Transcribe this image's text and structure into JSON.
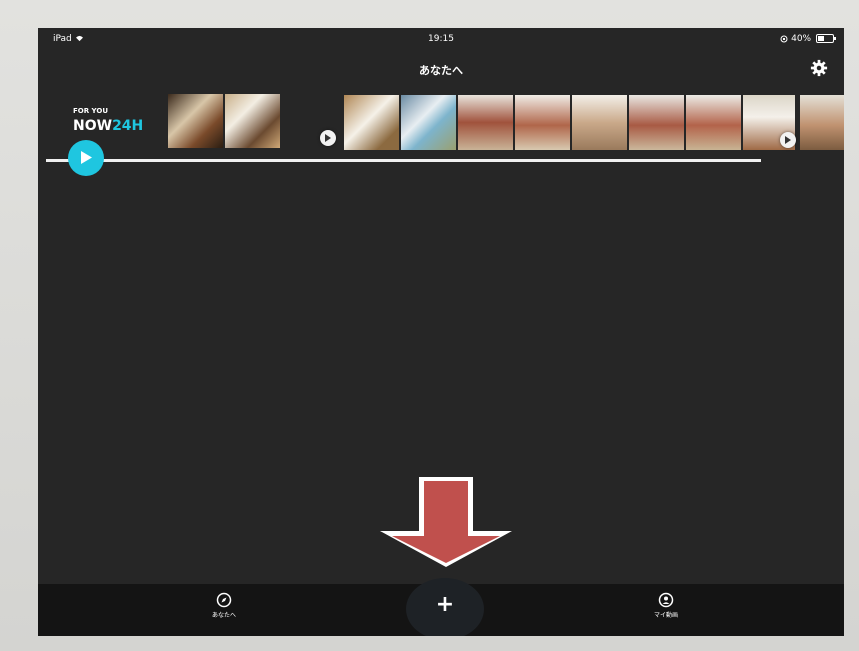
{
  "status_bar": {
    "device": "iPad",
    "time": "19:15",
    "battery": "40%"
  },
  "nav": {
    "title": "あなたへ"
  },
  "brand": {
    "subtitle": "FOR YOU",
    "title_main": "NOW",
    "title_accent": "24H"
  },
  "tabs": [
    {
      "label": "あなたへ",
      "icon": "compass-icon"
    },
    {
      "label": "",
      "icon": "plus-icon"
    },
    {
      "label": "マイ動画",
      "icon": "profile-icon"
    }
  ],
  "add_button": {
    "label": "+"
  },
  "colors": {
    "accent": "#1fc6e0",
    "background": "#262626",
    "annotation_arrow": "#c0504d"
  }
}
